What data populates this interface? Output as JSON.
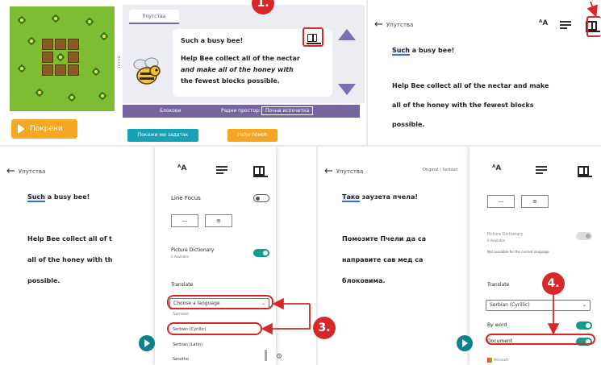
{
  "puzzle": {
    "run_button": "Покрени",
    "tab_label": "Упутства",
    "instruction_line1": "Such a busy bee!",
    "instruction_line2": "Help Bee collect all of the nectar",
    "instruction_line3": "and make all of the honey with",
    "instruction_line4": "the fewest blocks possible.",
    "bar_left": "Блокови",
    "bar_mid": "Радни простор:",
    "bar_right": "Почни испочетка",
    "button_blue": "Покажи ми задатак",
    "button_orange": "Нађи помоћ"
  },
  "reader_top": {
    "back_label": "Упутства",
    "line1_highlight": "Such",
    "line1_rest": " a busy bee!",
    "line2": "Help Bee collect all of the nectar and make",
    "line3": "all of the honey with the fewest blocks",
    "line4": "possible."
  },
  "reader_bottom_left": {
    "back_label": "Упутства",
    "line1_highlight": "Such",
    "line1_rest": " a busy bee!",
    "line2": "Help Bee collect all of t",
    "line3": "all of the honey with th",
    "line4": "possible.",
    "settings": {
      "line_focus": "Line Focus",
      "seg1": "—",
      "seg2": "≡",
      "picture_dictionary": "Picture Dictionary",
      "picture_dictionary_sub": "2 Available",
      "translate": "Translate",
      "select_value": "Choose a language",
      "option_0": "Samoan",
      "option_1": "Serbian (Cyrillic)",
      "option_2": "Serbian (Latin)",
      "option_3": "Sesotho"
    }
  },
  "reader_bottom_right": {
    "back_label": "Упутства",
    "top_right_label": "Original | Serbian",
    "line1_highlight": "Тако",
    "line1_rest": " заузета пчела!",
    "line2": "Помозите Пчели да са",
    "line3": "направите сав мед са",
    "line4": "блоковима.",
    "settings": {
      "seg1": "—",
      "seg2": "≡",
      "picture_dictionary": "Picture Dictionary",
      "picture_dictionary_sub": "0 Available",
      "not_available": "Not available for the current language",
      "translate": "Translate",
      "select_value": "Serbian (Cyrillic)",
      "by_word": "By word",
      "document": "Document",
      "powered": "Microsoft"
    }
  },
  "callouts": {
    "c1": "1.",
    "c3": "3.",
    "c4": "4."
  },
  "colors": {
    "callout_red": "#d62828",
    "toggle_on": "#0f9d8c",
    "codeorg_purple": "#7665a0",
    "run_orange": "#f5a623"
  }
}
